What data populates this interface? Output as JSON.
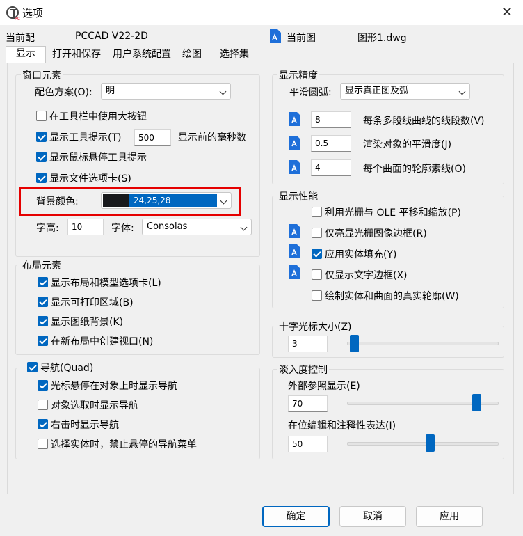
{
  "window": {
    "title": "选项",
    "close_glyph": "✕"
  },
  "profile": {
    "label": "当前配",
    "value": "PCCAD V22-2D"
  },
  "drawing": {
    "label": "当前图",
    "value": "图形1.dwg"
  },
  "tabs": [
    "显示",
    "打开和保存",
    "用户系统配置",
    "绘图",
    "选择集"
  ],
  "window_elements": {
    "title": "窗口元素",
    "color_scheme": {
      "label": "配色方案(O):",
      "value": "明"
    },
    "large_buttons": {
      "label": "在工具栏中使用大按钮",
      "checked": false
    },
    "tooltips": {
      "label": "显示工具提示(T)",
      "checked": true,
      "delay": "500",
      "delay_label": "显示前的毫秒数"
    },
    "rollover": {
      "label": "显示鼠标悬停工具提示",
      "checked": true
    },
    "file_tabs": {
      "label": "显示文件选项卡(S)",
      "checked": true
    },
    "background": {
      "label": "背景颜色:",
      "value": "24,25,28",
      "swatch": "#18191c",
      "highlight": "#0067c0"
    },
    "font_size": {
      "label": "字高:",
      "value": "10"
    },
    "font": {
      "label": "字体:",
      "value": "Consolas"
    }
  },
  "layout_elements": {
    "title": "布局元素",
    "items": [
      {
        "label": "显示布局和模型选项卡(L)",
        "checked": true
      },
      {
        "label": "显示可打印区域(B)",
        "checked": true
      },
      {
        "label": "显示图纸背景(K)",
        "checked": true
      },
      {
        "label": "在新布局中创建视口(N)",
        "checked": true
      }
    ]
  },
  "navigation": {
    "title": "导航(Quad)",
    "checked": true,
    "items": [
      {
        "label": "光标悬停在对象上时显示导航",
        "checked": true
      },
      {
        "label": "对象选取时显示导航",
        "checked": false
      },
      {
        "label": "右击时显示导航",
        "checked": true
      },
      {
        "label": "选择实体时，禁止悬停的导航菜单",
        "checked": false
      }
    ]
  },
  "display_resolution": {
    "title": "显示精度",
    "arc_smoothing": {
      "label": "平滑圆弧:",
      "value": "显示真正图及弧"
    },
    "fields": [
      {
        "value": "8",
        "label": "每条多段线曲线的线段数(V)"
      },
      {
        "value": "0.5",
        "label": "渲染对象的平滑度(J)"
      },
      {
        "value": "4",
        "label": "每个曲面的轮廓素线(O)"
      }
    ]
  },
  "display_performance": {
    "title": "显示性能",
    "items": [
      {
        "label": "利用光栅与 OLE 平移和缩放(P)",
        "checked": false
      },
      {
        "label": "仅亮显光栅图像边框(R)",
        "checked": false
      },
      {
        "label": "应用实体填充(Y)",
        "checked": true
      },
      {
        "label": "仅显示文字边框(X)",
        "checked": false
      },
      {
        "label": "绘制实体和曲面的真实轮廓(W)",
        "checked": false
      }
    ]
  },
  "crosshair": {
    "title": "十字光标大小(Z)",
    "value": "3",
    "fraction": 0.03
  },
  "fade_control": {
    "title": "淡入度控制",
    "xref": {
      "label": "外部参照显示(E)",
      "value": "70",
      "fraction": 0.7
    },
    "inplace": {
      "label": "在位编辑和注释性表达(I)",
      "value": "50",
      "fraction": 0.5
    }
  },
  "buttons": {
    "ok": "确定",
    "cancel": "取消",
    "apply": "应用"
  },
  "colors": {
    "accent": "#0067c0",
    "highlight_box": "#e50000"
  }
}
